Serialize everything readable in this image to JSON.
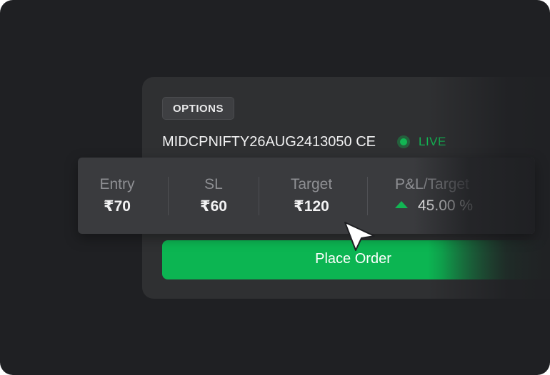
{
  "card": {
    "badge": "OPTIONS",
    "symbol": "MIDCPNIFTY26AUG2413050 CE",
    "status": "LIVE"
  },
  "stats": {
    "entry": {
      "label": "Entry",
      "value": "₹70"
    },
    "sl": {
      "label": "SL",
      "value": "₹60"
    },
    "target": {
      "label": "Target",
      "value": "₹120"
    },
    "pnl": {
      "label": "P&L/Target",
      "value": "45.00 %",
      "trend_icon": "triangle-up-icon",
      "trend_color": "#12b553"
    }
  },
  "actions": {
    "place_order": "Place Order"
  },
  "colors": {
    "accent": "#0cb552",
    "live": "#12b553",
    "background": "#1f2023",
    "card": "#2f3032"
  },
  "cursor_icon": "mouse-pointer-icon"
}
